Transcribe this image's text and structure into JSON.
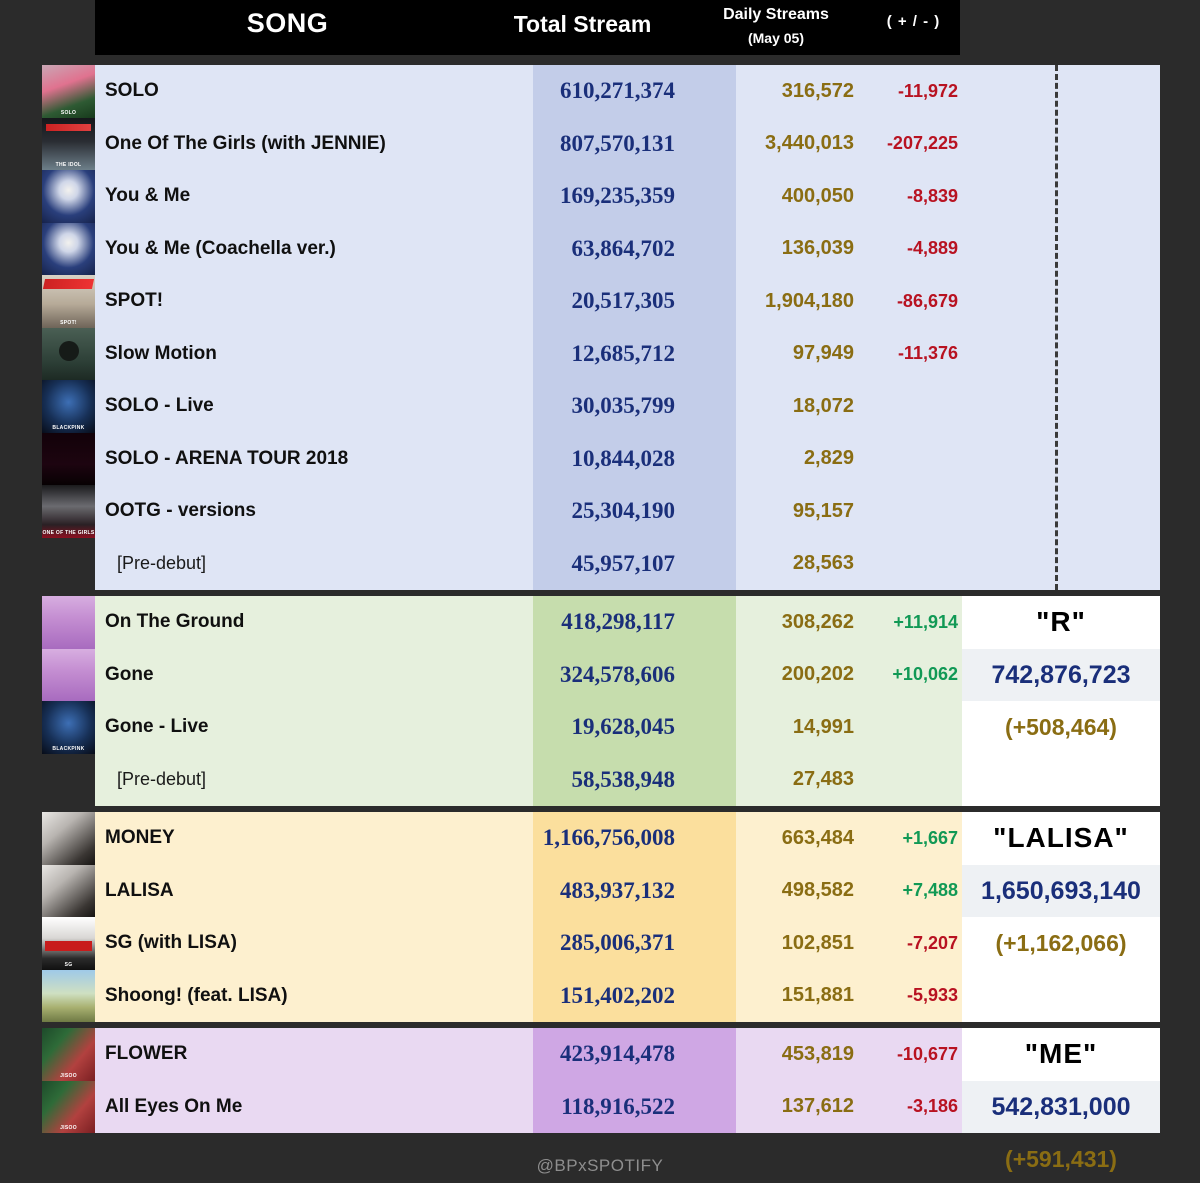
{
  "header": {
    "col_song": "SONG",
    "col_total": "Total Stream",
    "col_daily": "Daily Streams",
    "col_daily_sub": "(May 05)",
    "col_delta": "( + / - )"
  },
  "watermark": "@BPxSPOTIFY",
  "colors": {
    "blue_section_bg": "#dfe5f5",
    "blue_section_band": "#c3cde9",
    "green_section_bg": "#e6f0dd",
    "green_section_band": "#c6ddad",
    "orange_section_bg": "#fdf0cf",
    "orange_section_band": "#fbdf9d",
    "purple_section_bg": "#e9d9f2",
    "purple_section_band": "#cfa7e4",
    "total_text": "#1a2f7a",
    "daily_text": "#8a6d13",
    "negative": "#b81221",
    "positive": "#119955",
    "header_bg": "#000000",
    "page_bg": "#2b2b2b"
  },
  "sections": [
    {
      "id": "jennie",
      "bg": "#dfe5f5",
      "band": "#c3cde9",
      "summary": null,
      "rows": [
        {
          "art": "a-solo",
          "art_label": "SOLO",
          "song": "SOLO",
          "total": "610,271,374",
          "daily": "316,572",
          "delta": "-11,972",
          "delta_sign": "neg"
        },
        {
          "art": "a-idol",
          "art_label": "THE IDOL",
          "song": "One Of The Girls (with JENNIE)",
          "total": "807,570,131",
          "daily": "3,440,013",
          "delta": "-207,225",
          "delta_sign": "neg"
        },
        {
          "art": "a-yam",
          "art_label": "",
          "song": "You & Me",
          "total": "169,235,359",
          "daily": "400,050",
          "delta": "-8,839",
          "delta_sign": "neg"
        },
        {
          "art": "a-yam",
          "art_label": "",
          "song": "You & Me (Coachella ver.)",
          "total": "63,864,702",
          "daily": "136,039",
          "delta": "-4,889",
          "delta_sign": "neg"
        },
        {
          "art": "a-spot",
          "art_label": "SPOT!",
          "song": "SPOT!",
          "total": "20,517,305",
          "daily": "1,904,180",
          "delta": "-86,679",
          "delta_sign": "neg"
        },
        {
          "art": "a-slow",
          "art_label": "",
          "song": "Slow Motion",
          "total": "12,685,712",
          "daily": "97,949",
          "delta": "-11,376",
          "delta_sign": "neg"
        },
        {
          "art": "a-show",
          "art_label": "BLACKPINK",
          "song": "SOLO - Live",
          "total": "30,035,799",
          "daily": "18,072",
          "delta": "",
          "delta_sign": ""
        },
        {
          "art": "a-arena",
          "art_label": "",
          "song": "SOLO - ARENA TOUR 2018",
          "total": "10,844,028",
          "daily": "2,829",
          "delta": "",
          "delta_sign": ""
        },
        {
          "art": "a-ootg",
          "art_label": "ONE OF THE GIRLS",
          "song": "OOTG - versions",
          "total": "25,304,190",
          "daily": "95,157",
          "delta": "",
          "delta_sign": ""
        },
        {
          "art": null,
          "art_label": "",
          "song": "[Pre-debut]",
          "predebut": true,
          "total": "45,957,107",
          "daily": "28,563",
          "delta": "",
          "delta_sign": ""
        }
      ]
    },
    {
      "id": "rose",
      "bg": "#e6f0dd",
      "band": "#c6ddad",
      "summary": {
        "title": "\"R\"",
        "total": "742,876,723",
        "gain": "(+508,464)"
      },
      "rows": [
        {
          "art": "a-otg",
          "art_label": "",
          "song": "On The Ground",
          "total": "418,298,117",
          "daily": "308,262",
          "delta": "+11,914",
          "delta_sign": "pos"
        },
        {
          "art": "a-otg",
          "art_label": "",
          "song": "Gone",
          "total": "324,578,606",
          "daily": "200,202",
          "delta": "+10,062",
          "delta_sign": "pos"
        },
        {
          "art": "a-show",
          "art_label": "BLACKPINK",
          "song": "Gone - Live",
          "total": "19,628,045",
          "daily": "14,991",
          "delta": "",
          "delta_sign": ""
        },
        {
          "art": null,
          "art_label": "",
          "song": "[Pre-debut]",
          "predebut": true,
          "total": "58,538,948",
          "daily": "27,483",
          "delta": "",
          "delta_sign": ""
        }
      ]
    },
    {
      "id": "lisa",
      "bg": "#fdf0cf",
      "band": "#fbdf9d",
      "summary": {
        "title": "\"LALISA\"",
        "total": "1,650,693,140",
        "gain": "(+1,162,066)"
      },
      "rows": [
        {
          "art": "a-money",
          "art_label": "",
          "song": "MONEY",
          "total": "1,166,756,008",
          "daily": "663,484",
          "delta": "+1,667",
          "delta_sign": "pos"
        },
        {
          "art": "a-money",
          "art_label": "",
          "song": "LALISA",
          "total": "483,937,132",
          "daily": "498,582",
          "delta": "+7,488",
          "delta_sign": "pos"
        },
        {
          "art": "a-sg",
          "art_label": "SG",
          "song": "SG (with LISA)",
          "total": "285,006,371",
          "daily": "102,851",
          "delta": "-7,207",
          "delta_sign": "neg"
        },
        {
          "art": "a-shoong",
          "art_label": "",
          "song": "Shoong! (feat. LISA)",
          "total": "151,402,202",
          "daily": "151,881",
          "delta": "-5,933",
          "delta_sign": "neg"
        }
      ]
    },
    {
      "id": "jisoo",
      "bg": "#e9d9f2",
      "band": "#cfa7e4",
      "summary": {
        "title": "\"ME\"",
        "total": "542,831,000",
        "gain": "(+591,431)"
      },
      "rows": [
        {
          "art": "a-flower",
          "art_label": "JISOO",
          "song": "FLOWER",
          "total": "423,914,478",
          "daily": "453,819",
          "delta": "-10,677",
          "delta_sign": "neg"
        },
        {
          "art": "a-flower",
          "art_label": "JISOO",
          "song": "All Eyes On Me",
          "total": "118,916,522",
          "daily": "137,612",
          "delta": "-3,186",
          "delta_sign": "neg"
        }
      ]
    }
  ]
}
